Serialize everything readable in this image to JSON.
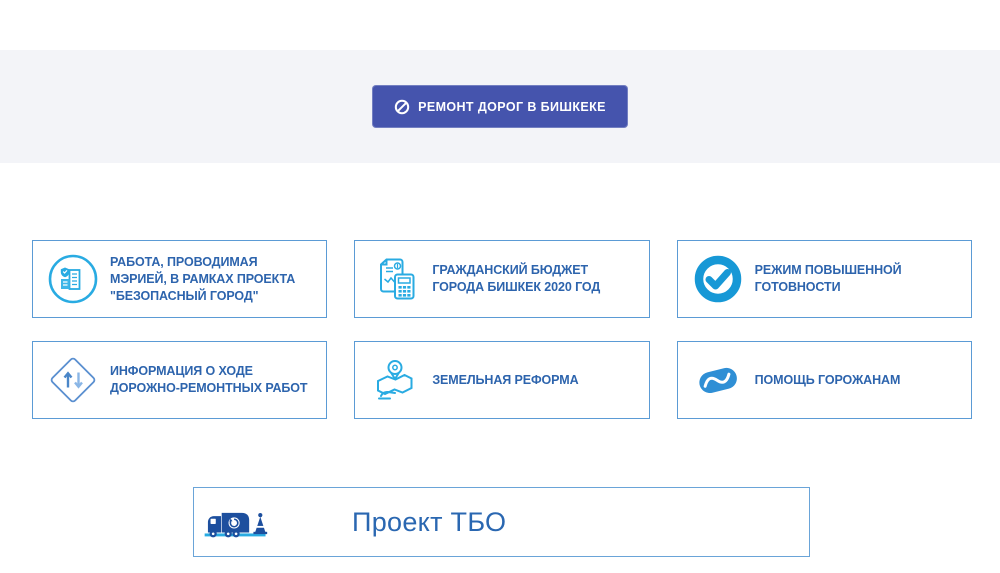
{
  "hero": {
    "band_color": "#f3f4f8",
    "button": {
      "label": "РЕМОНТ ДОРОГ В БИШКЕКЕ",
      "icon": "no-entry-icon",
      "bg_color": "#4554ad",
      "text_color": "#ffffff"
    }
  },
  "cards": [
    {
      "id": "safe-city",
      "icon": "city-shield-icon",
      "label": "РАБОТА, ПРОВОДИМАЯ МЭРИЕЙ, В РАМКАХ ПРОЕКТА \"БЕЗОПАСНЫЙ ГОРОД\""
    },
    {
      "id": "budget",
      "icon": "budget-calculator-icon",
      "label": "ГРАЖДАНСКИЙ БЮДЖЕТ ГОРОДА БИШКЕК 2020 ГОД"
    },
    {
      "id": "readiness",
      "icon": "check-circle-icon",
      "label": "РЕЖИМ ПОВЫШЕННОЙ ГОТОВНОСТИ"
    },
    {
      "id": "roadworks",
      "icon": "diamond-arrows-icon",
      "label": "ИНФОРМАЦИЯ О ХОДЕ ДОРОЖНО-РЕМОНТНЫХ РАБОТ"
    },
    {
      "id": "land-reform",
      "icon": "map-pin-hand-icon",
      "label": "ЗЕМЕЛЬНАЯ РЕФОРМА"
    },
    {
      "id": "help",
      "icon": "handshake-icon",
      "label": "ПОМОЩЬ ГОРОЖАНАМ"
    }
  ],
  "tbo": {
    "label": "Проект ТБО",
    "icon": "garbage-truck-icon"
  },
  "colors": {
    "card_border": "#5b9bd5",
    "card_text": "#2d64ad",
    "icon_light_blue": "#29abe2",
    "icon_solid_blue": "#1798d6",
    "handshake_blue": "#2f8fd5",
    "roadworks_stroke": "#5a8fd0",
    "truck_navy": "#1d4f9e",
    "ground_light_blue": "#29abe2",
    "tbo_text": "#2a67b1"
  }
}
